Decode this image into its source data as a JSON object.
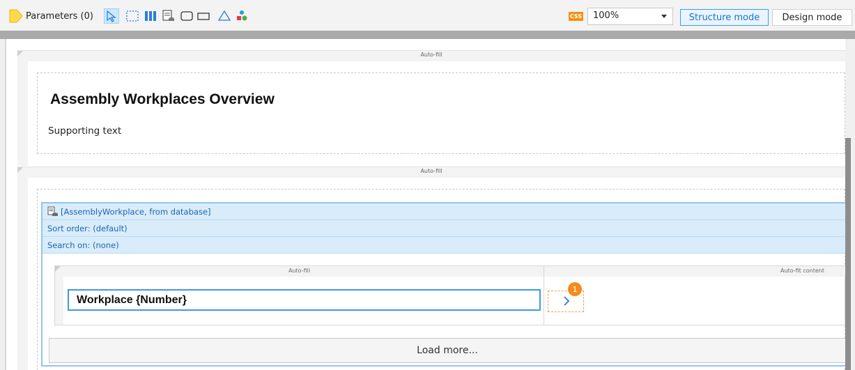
{
  "toolbar": {
    "parameters_label": "Parameters (0)",
    "css_badge": "CSS",
    "zoom_value": "100%",
    "structure_mode_label": "Structure mode",
    "design_mode_label": "Design mode",
    "icons": [
      "parameters-icon",
      "select-pointer-icon",
      "dashed-container-icon",
      "columns-icon",
      "list-db-icon",
      "rounded-box-icon",
      "flat-box-icon",
      "triangle-icon",
      "component-icon"
    ]
  },
  "canvas": {
    "section1": {
      "header_label": "Auto-fill",
      "title": "Assembly Workplaces Overview",
      "supporting_text": "Supporting text"
    },
    "section2": {
      "header_label": "Auto-fill",
      "list": {
        "source": "[AssemblyWorkplace, from database]",
        "sort_order": "Sort order: (default)",
        "search_on": "Search on: (none)",
        "left_column_label": "Auto-fill",
        "right_column_label": "Auto-fit content",
        "item_text": "Workplace {Number}",
        "badge_count": "1",
        "load_more_label": "Load more..."
      }
    }
  },
  "colors": {
    "accent_blue": "#3c9ae8",
    "list_bg": "#d9ecfa",
    "orange": "#f28c1c"
  }
}
